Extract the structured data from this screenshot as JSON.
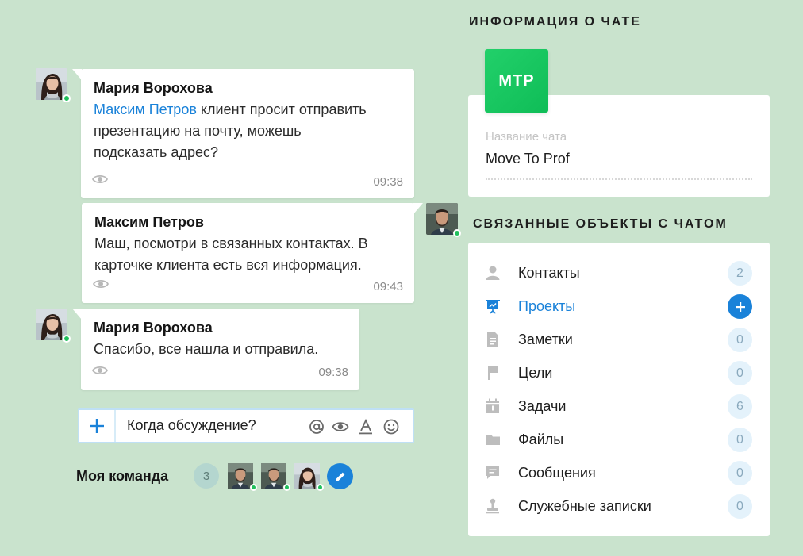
{
  "colors": {
    "background": "#c9e3cd",
    "accent": "#1a82d9",
    "online": "#21c05c",
    "logo_green": "#14c55c"
  },
  "messages": [
    {
      "author": "Мария Ворохова",
      "mention": "Максим Петров",
      "lines": [
        "клиент просит отправить",
        "презентацию на почту, можешь",
        "подсказать адрес?"
      ],
      "time": "09:38",
      "icon": "eye-icon"
    },
    {
      "author": "Максим Петров",
      "lines": [
        "Маш, посмотри в связанных контактах. В",
        "карточке клиента есть вся информация."
      ],
      "time": "09:43",
      "icon": "eye-icon"
    },
    {
      "author": "Мария Ворохова",
      "lines": [
        "Спасибо, все нашла и отправила."
      ],
      "time": "09:38",
      "icon": "eye-icon"
    }
  ],
  "composer": {
    "value": "Когда обсуждение?",
    "tools": [
      "at-icon",
      "eye-icon",
      "text-format-icon",
      "smile-icon"
    ]
  },
  "team": {
    "label": "Моя команда",
    "count": "3"
  },
  "chat_info": {
    "title": "ИНФОРМАЦИЯ О ЧАТЕ",
    "logo_text": "МТР",
    "field_label": "Название чата",
    "field_value": "Move To Prof"
  },
  "linked": {
    "title": "СВЯЗАННЫЕ ОБЪЕКТЫ С ЧАТОМ",
    "items": [
      {
        "label": "Контакты",
        "count": "2",
        "icon": "person-icon"
      },
      {
        "label": "Проекты",
        "count": "",
        "icon": "presentation-icon",
        "active": true
      },
      {
        "label": "Заметки",
        "count": "0",
        "icon": "note-icon"
      },
      {
        "label": "Цели",
        "count": "0",
        "icon": "flag-icon"
      },
      {
        "label": "Задачи",
        "count": "6",
        "icon": "calendar-icon"
      },
      {
        "label": "Файлы",
        "count": "0",
        "icon": "folder-icon"
      },
      {
        "label": "Сообщения",
        "count": "0",
        "icon": "message-icon"
      },
      {
        "label": "Служебные записки",
        "count": "0",
        "icon": "stamp-icon"
      }
    ]
  }
}
